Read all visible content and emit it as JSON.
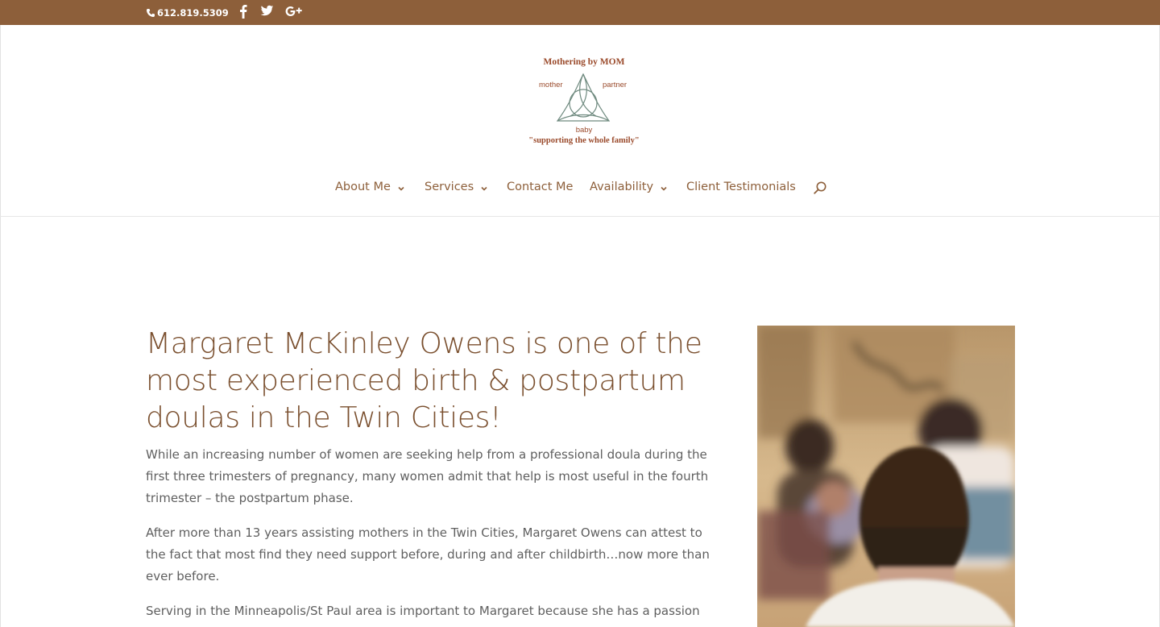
{
  "topbar": {
    "phone": "612.819.5309",
    "icons": [
      "phone-icon",
      "facebook-icon",
      "twitter-icon",
      "google-plus-icon"
    ],
    "colors": {
      "background": "#8d5f3a",
      "text": "#ffffff"
    }
  },
  "logo": {
    "title": "Mothering by MOM",
    "left_word": "mother",
    "right_word": "partner",
    "bottom_word": "baby",
    "tagline": "\"supporting the whole family\"",
    "icon": "trinity-knot-icon"
  },
  "nav": {
    "items": [
      {
        "label": "About Me",
        "has_dropdown": true
      },
      {
        "label": "Services",
        "has_dropdown": true
      },
      {
        "label": "Contact Me",
        "has_dropdown": false
      },
      {
        "label": "Availability",
        "has_dropdown": true
      },
      {
        "label": "Client Testimonials",
        "has_dropdown": false
      }
    ],
    "search_icon": "search-icon",
    "color": "#8d5f3a"
  },
  "main": {
    "headline": "Margaret McKinley Owens is one of the most experienced birth & postpartum doulas in the Twin Cities!",
    "paragraphs": [
      "While an increasing number of women are seeking help from a professional doula during the first three trimesters of pregnancy, many women admit that help is most useful in the fourth trimester – the postpartum phase.",
      "After more than 13 years assisting mothers in the Twin Cities, Margaret Owens can attest to the fact that most find they need support before, during and after childbirth…now more than ever before.",
      "Serving in the Minneapolis/St Paul area is important to Margaret because she has a passion for"
    ],
    "headline_color": "#7a4f2e"
  }
}
